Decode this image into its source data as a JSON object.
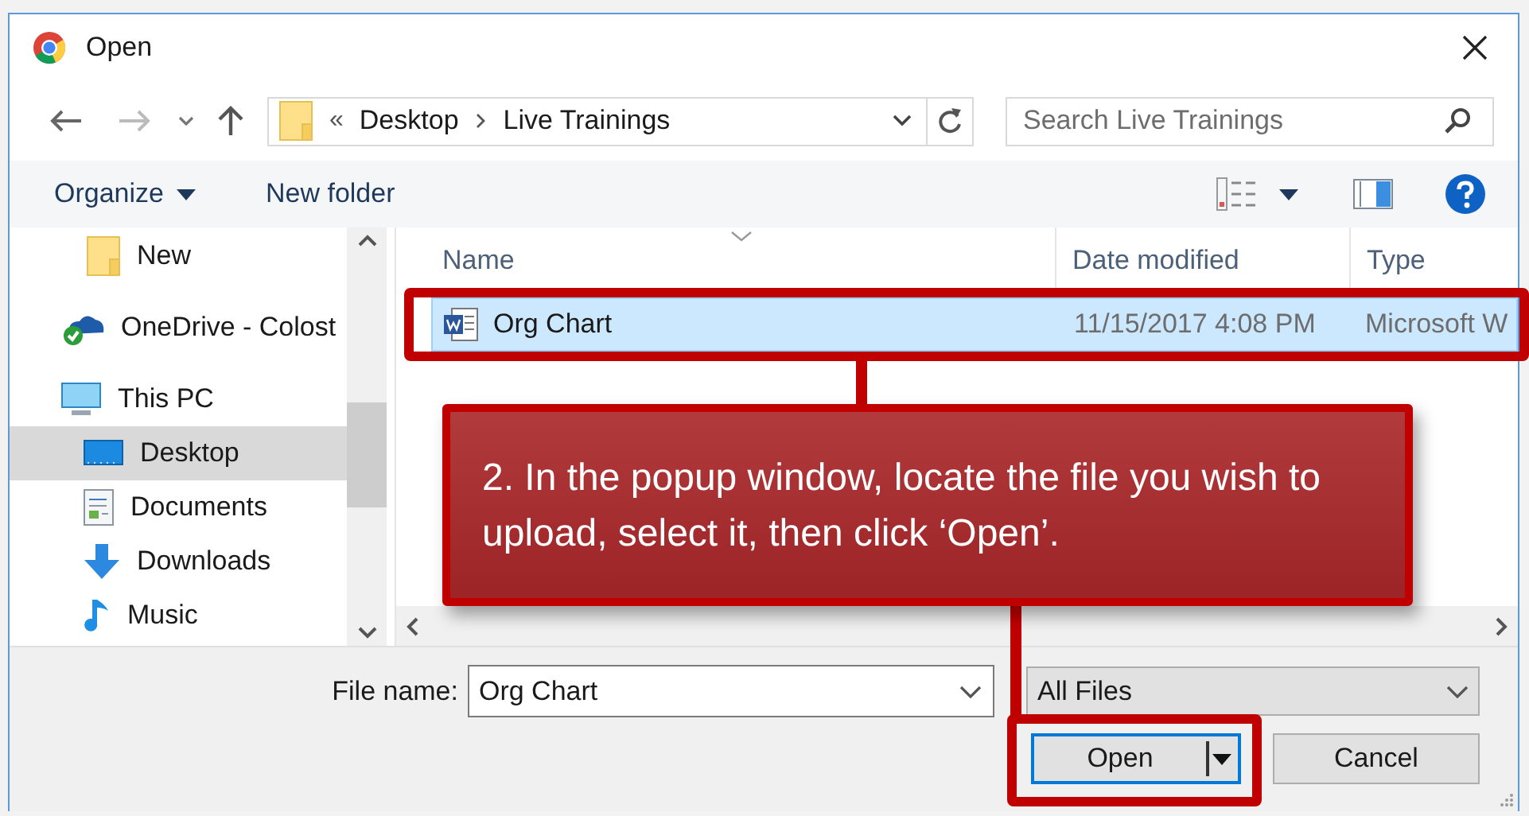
{
  "window": {
    "title": "Open"
  },
  "address_bar": {
    "overflow": "«",
    "path": [
      "Desktop",
      "Live Trainings"
    ]
  },
  "search": {
    "placeholder": "Search Live Trainings"
  },
  "toolbar": {
    "organize": "Organize",
    "new_folder": "New folder"
  },
  "sidebar": {
    "items": [
      {
        "label": "New",
        "kind": "folder",
        "selected": false
      },
      {
        "label": "OneDrive - Colost",
        "kind": "cloud",
        "selected": false
      },
      {
        "label": "This PC",
        "kind": "pc",
        "selected": false,
        "children": [
          {
            "label": "Desktop",
            "kind": "desktop",
            "selected": true
          },
          {
            "label": "Documents",
            "kind": "documents",
            "selected": false
          },
          {
            "label": "Downloads",
            "kind": "downloads",
            "selected": false
          },
          {
            "label": "Music",
            "kind": "music",
            "selected": false
          }
        ]
      }
    ]
  },
  "file_list": {
    "columns": [
      "Name",
      "Date modified",
      "Type"
    ],
    "rows": [
      {
        "name": "Org Chart",
        "date_modified": "11/15/2017 4:08 PM",
        "type": "Microsoft W",
        "selected": true
      }
    ]
  },
  "file_name": {
    "label": "File name:",
    "value": "Org Chart"
  },
  "file_type": {
    "value": "All Files"
  },
  "buttons": [
    {
      "label": "Open",
      "kind": "split"
    },
    {
      "label": "Cancel",
      "kind": "plain"
    }
  ],
  "annotation": {
    "text": "2. In the popup window, locate the file you wish to upload, select it, then click ‘Open’."
  }
}
